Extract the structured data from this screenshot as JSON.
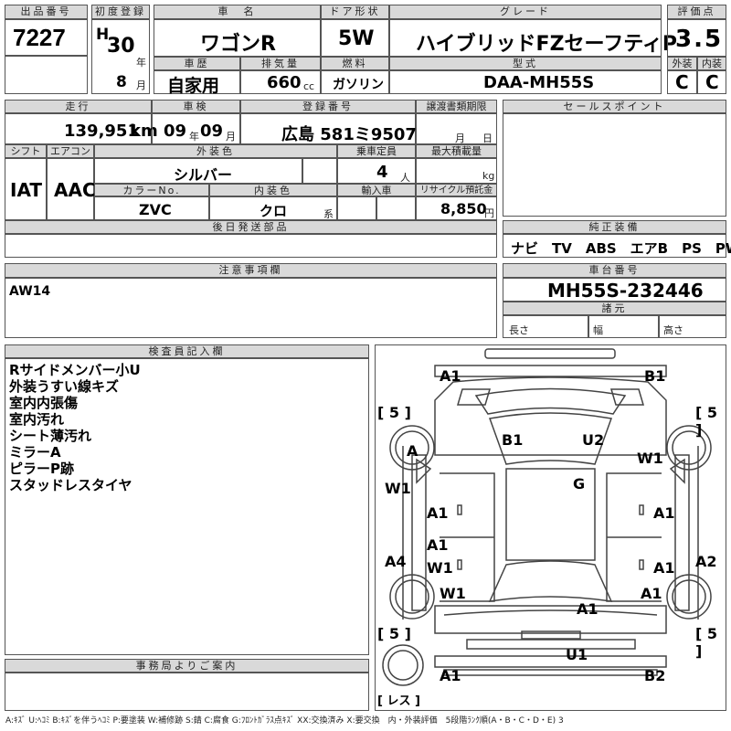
{
  "header": {
    "lot_label": "出品番号",
    "lot_no": "7227",
    "reg_label": "初度登録",
    "era": "H",
    "year": "30",
    "year_unit": "年",
    "month": "8",
    "month_unit": "月",
    "name_label": "車　名",
    "car_name": "ワゴンR",
    "door_label": "ドア形状",
    "door": "5W",
    "grade_label": "グレード",
    "grade": "ハイブリッドFZセーフティP",
    "score_label": "評価点",
    "score": "3.5",
    "history_label": "車歴",
    "history": "自家用",
    "disp_label": "排気量",
    "displacement": "660",
    "disp_unit": "cc",
    "fuel_label": "燃料",
    "fuel": "ガソリン",
    "model_label": "型式",
    "model": "DAA-MH55S",
    "ext_label": "外装",
    "ext": "C",
    "int_label": "内装",
    "int": "C"
  },
  "row2": {
    "mileage_label": "走行",
    "mileage": "139,951",
    "mileage_unit": "km",
    "inspection_label": "車検",
    "insp_year": "09",
    "insp_year_unit": "年",
    "insp_month": "09",
    "insp_month_unit": "月",
    "plate_label": "登録番号",
    "plate": "広島 581ミ9507",
    "transfer_label": "譲渡書類期限",
    "transfer_month_unit": "月",
    "transfer_day_unit": "日",
    "sales_label": "セールスポイント"
  },
  "row3": {
    "shift_label": "シフト",
    "shift": "IAT",
    "ac_label": "エアコン",
    "ac": "AAC",
    "color_label": "外装色",
    "color": "シルバー",
    "capacity_label": "乗車定員",
    "capacity": "4",
    "capacity_unit": "人",
    "load_label": "最大積載量",
    "load_unit": "kg",
    "color_no_label": "カラーNo.",
    "color_no": "ZVC",
    "interior_label": "内装色",
    "interior": "クロ",
    "interior_unit": "系",
    "import_label": "輸入車",
    "recycle_label": "リサイクル預託金",
    "recycle": "8,850",
    "recycle_unit": "円",
    "later_label": "後日発送部品",
    "equip_label": "純正装備",
    "equip": "ナビ　TV　ABS　エアB　PS　PW"
  },
  "notes": {
    "caution_label": "注意事項欄",
    "caution": "AW14",
    "chassis_label": "車台番号",
    "chassis": "MH55S-232446",
    "spec_label": "諸元",
    "length_label": "長さ",
    "width_label": "幅",
    "height_label": "高さ"
  },
  "inspector": {
    "label": "検査員記入欄",
    "lines": [
      "Rサイドメンバー小U",
      "外装うすい線キズ",
      "室内内張傷",
      "室内汚れ",
      "シート薄汚れ",
      "ミラーA",
      "ピラーP跡",
      "スタッドレスタイヤ"
    ]
  },
  "office": {
    "label": "事務局よりご案内"
  },
  "diagram": {
    "front_left": "A1",
    "front_right": "B1",
    "tire_fl": "5",
    "tire_fr": "5",
    "tire_rl": "5",
    "tire_rr": "5",
    "wheel_fl": "A",
    "wheel_fr": "W1",
    "roof_left": "B1",
    "roof_right": "U2",
    "roof": "G",
    "left_front_panel": "W1",
    "left_door_front": "A1",
    "right_door_front": "A1",
    "left_lower": "A4",
    "left_door_rear1": "A1",
    "left_door_rear2": "W1",
    "right_lower": "A2",
    "right_door_rear": "A1",
    "rear_wheel_left": "W1",
    "rear_wheel_right": "A1",
    "trunk": "A1",
    "rear_bumper": "U1",
    "rear_left": "A1",
    "rear_right": "B2",
    "spare": "レス"
  },
  "legend": "A:ｷｽﾞ U:ﾍｺﾐ B:ｷｽﾞを伴うﾍｺﾐ P:要塗装 W:補修跡 S:錆 C:腐食 G:ﾌﾛﾝﾄｶﾞﾗｽ点ｷｽﾞ XX:交換済み X:要交換　内・外装評価　5段階ﾗﾝｸ順(A・B・C・D・E) 3"
}
